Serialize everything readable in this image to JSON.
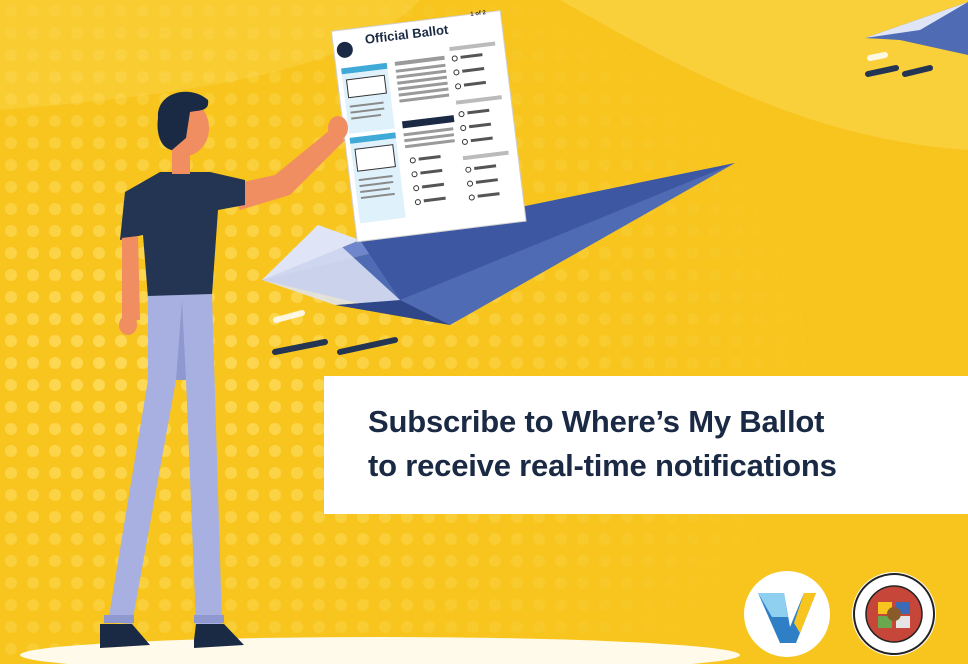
{
  "ballot": {
    "title": "Official Ballot",
    "page": "1 of 2"
  },
  "message": {
    "line1": "Subscribe to Where’s My Ballot",
    "line2": "to receive real-time notifications"
  },
  "logos": {
    "vote_logo_icon": "v-logo-icon",
    "county_seal_text": "REGISTRAR-RECORDER/COUNTY CLERK • COUNTY OF LOS ANGELES • CALIFORNIA"
  },
  "colors": {
    "background_yellow": "#f7c51e",
    "accent_blue": "#4f6bb4",
    "dark_navy": "#1b2a44",
    "pants_blue": "#a7b0e0",
    "skin": "#f08e62"
  }
}
